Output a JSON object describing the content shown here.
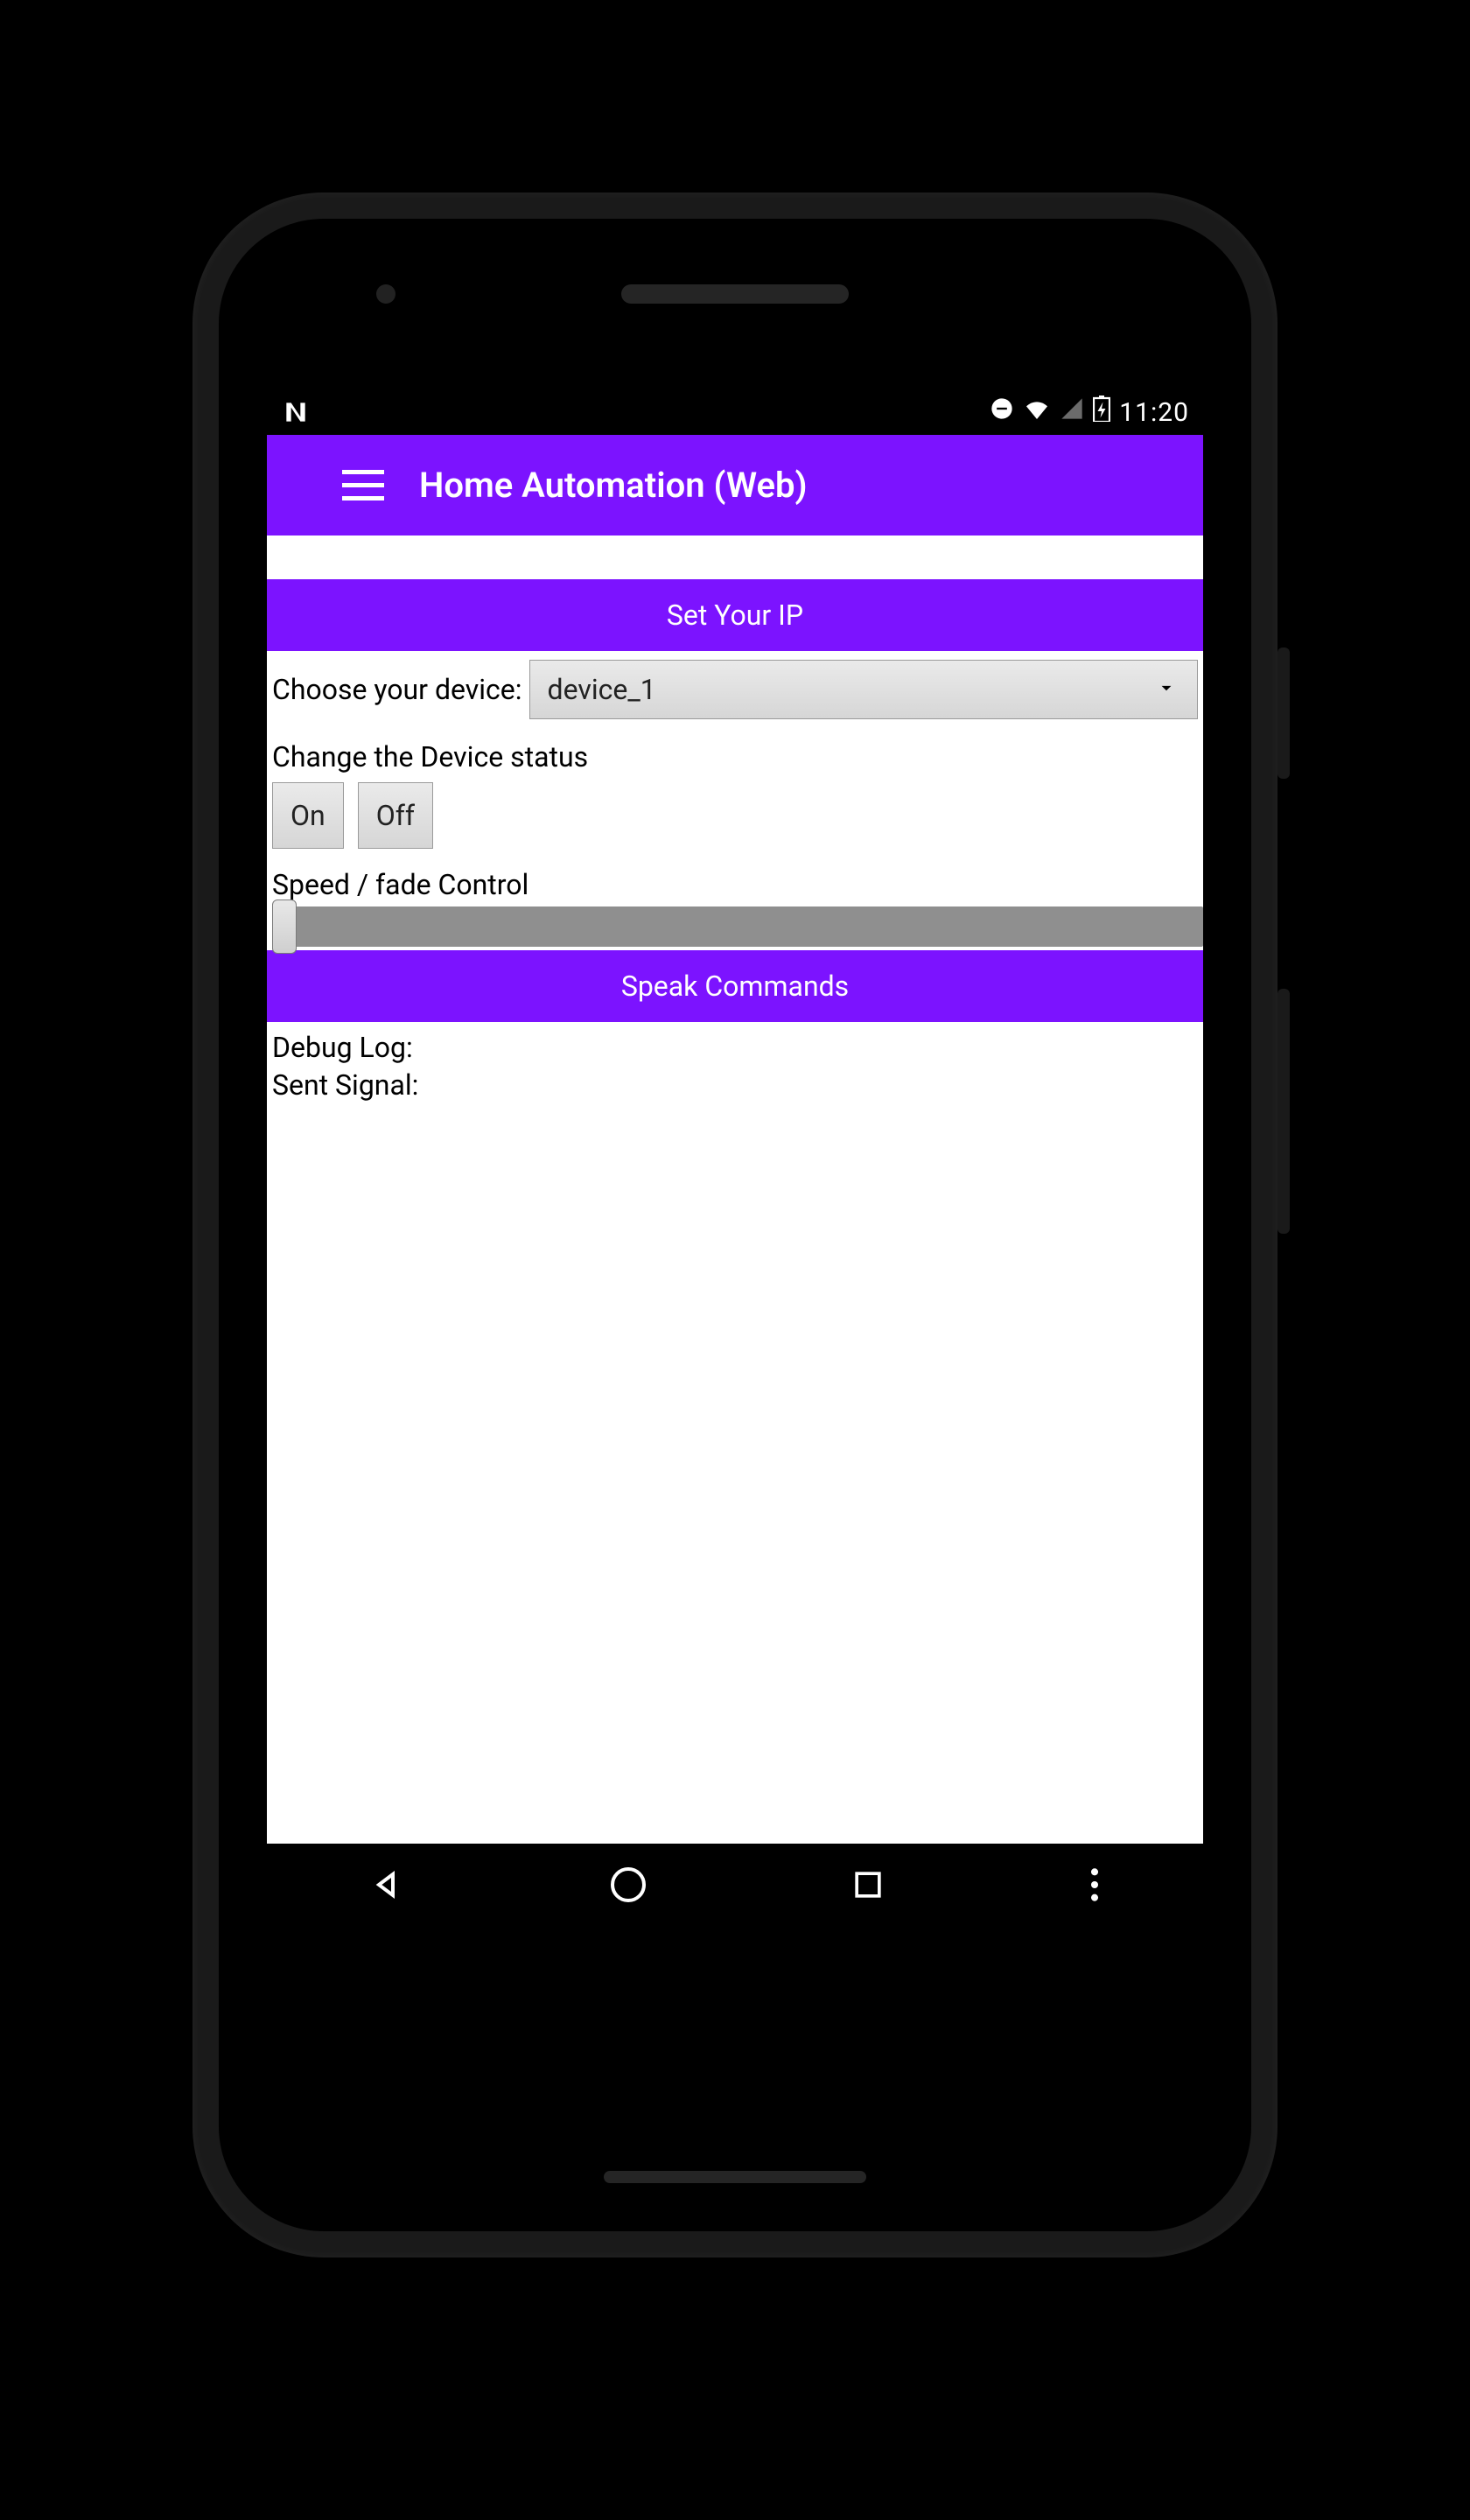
{
  "status": {
    "clock": "11:20"
  },
  "appbar": {
    "title": "Home Automation (Web)"
  },
  "buttons": {
    "set_ip": "Set  Your IP",
    "speak": "Speak Commands",
    "on": "On",
    "off": "Off"
  },
  "labels": {
    "choose_device": "Choose your device:",
    "change_status": "Change the Device status",
    "speed_fade": "Speed / fade Control",
    "debug_log": "Debug Log:",
    "sent_signal": "Sent Signal:"
  },
  "dropdown": {
    "selected": "device_1"
  }
}
